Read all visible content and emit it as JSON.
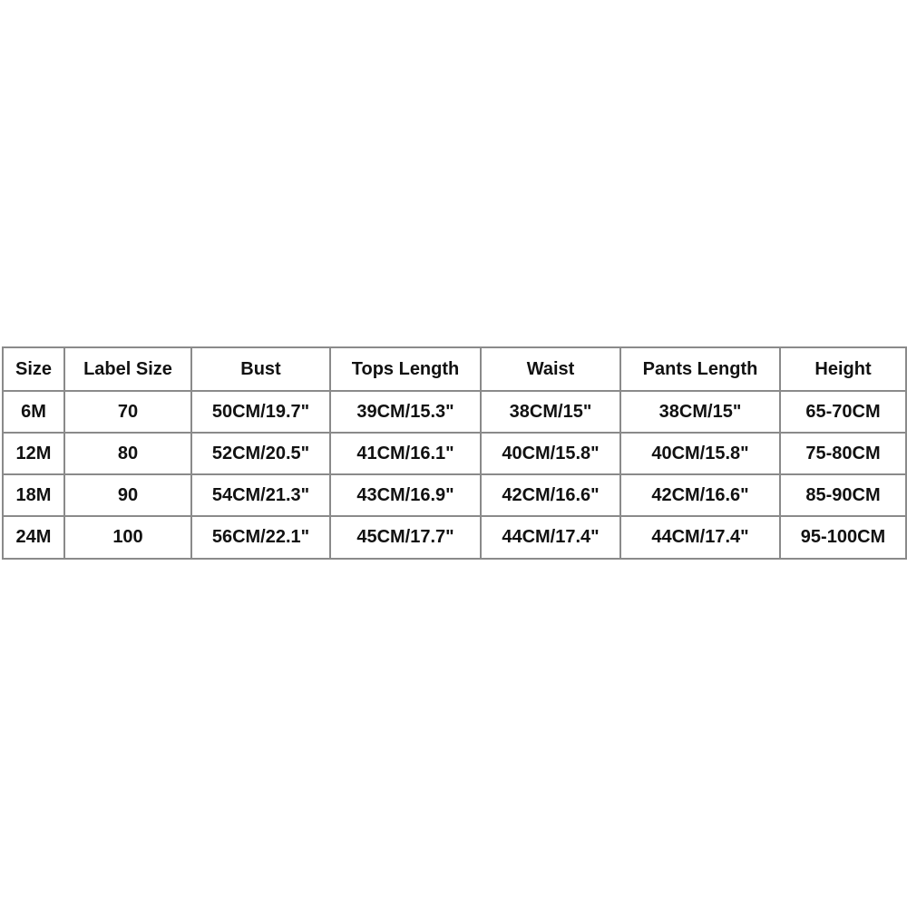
{
  "size_chart": {
    "headers": [
      "Size",
      "Label Size",
      "Bust",
      "Tops Length",
      "Waist",
      "Pants Length",
      "Height"
    ],
    "rows": [
      [
        "6M",
        "70",
        "50CM/19.7\"",
        "39CM/15.3\"",
        "38CM/15\"",
        "38CM/15\"",
        "65-70CM"
      ],
      [
        "12M",
        "80",
        "52CM/20.5\"",
        "41CM/16.1\"",
        "40CM/15.8\"",
        "40CM/15.8\"",
        "75-80CM"
      ],
      [
        "18M",
        "90",
        "54CM/21.3\"",
        "43CM/16.9\"",
        "42CM/16.6\"",
        "42CM/16.6\"",
        "85-90CM"
      ],
      [
        "24M",
        "100",
        "56CM/22.1\"",
        "45CM/17.7\"",
        "44CM/17.4\"",
        "44CM/17.4\"",
        "95-100CM"
      ]
    ]
  }
}
